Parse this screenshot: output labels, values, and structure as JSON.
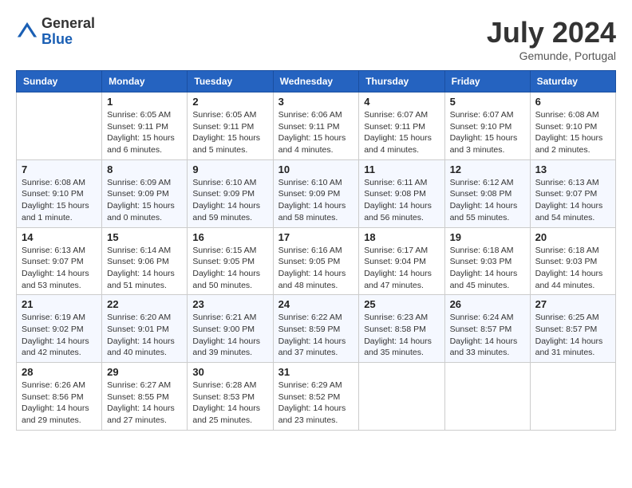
{
  "header": {
    "logo_general": "General",
    "logo_blue": "Blue",
    "month_title": "July 2024",
    "location": "Gemunde, Portugal"
  },
  "weekdays": [
    "Sunday",
    "Monday",
    "Tuesday",
    "Wednesday",
    "Thursday",
    "Friday",
    "Saturday"
  ],
  "weeks": [
    [
      {
        "day": "",
        "sunrise": "",
        "sunset": "",
        "daylight": ""
      },
      {
        "day": "1",
        "sunrise": "Sunrise: 6:05 AM",
        "sunset": "Sunset: 9:11 PM",
        "daylight": "Daylight: 15 hours and 6 minutes."
      },
      {
        "day": "2",
        "sunrise": "Sunrise: 6:05 AM",
        "sunset": "Sunset: 9:11 PM",
        "daylight": "Daylight: 15 hours and 5 minutes."
      },
      {
        "day": "3",
        "sunrise": "Sunrise: 6:06 AM",
        "sunset": "Sunset: 9:11 PM",
        "daylight": "Daylight: 15 hours and 4 minutes."
      },
      {
        "day": "4",
        "sunrise": "Sunrise: 6:07 AM",
        "sunset": "Sunset: 9:11 PM",
        "daylight": "Daylight: 15 hours and 4 minutes."
      },
      {
        "day": "5",
        "sunrise": "Sunrise: 6:07 AM",
        "sunset": "Sunset: 9:10 PM",
        "daylight": "Daylight: 15 hours and 3 minutes."
      },
      {
        "day": "6",
        "sunrise": "Sunrise: 6:08 AM",
        "sunset": "Sunset: 9:10 PM",
        "daylight": "Daylight: 15 hours and 2 minutes."
      }
    ],
    [
      {
        "day": "7",
        "sunrise": "Sunrise: 6:08 AM",
        "sunset": "Sunset: 9:10 PM",
        "daylight": "Daylight: 15 hours and 1 minute."
      },
      {
        "day": "8",
        "sunrise": "Sunrise: 6:09 AM",
        "sunset": "Sunset: 9:09 PM",
        "daylight": "Daylight: 15 hours and 0 minutes."
      },
      {
        "day": "9",
        "sunrise": "Sunrise: 6:10 AM",
        "sunset": "Sunset: 9:09 PM",
        "daylight": "Daylight: 14 hours and 59 minutes."
      },
      {
        "day": "10",
        "sunrise": "Sunrise: 6:10 AM",
        "sunset": "Sunset: 9:09 PM",
        "daylight": "Daylight: 14 hours and 58 minutes."
      },
      {
        "day": "11",
        "sunrise": "Sunrise: 6:11 AM",
        "sunset": "Sunset: 9:08 PM",
        "daylight": "Daylight: 14 hours and 56 minutes."
      },
      {
        "day": "12",
        "sunrise": "Sunrise: 6:12 AM",
        "sunset": "Sunset: 9:08 PM",
        "daylight": "Daylight: 14 hours and 55 minutes."
      },
      {
        "day": "13",
        "sunrise": "Sunrise: 6:13 AM",
        "sunset": "Sunset: 9:07 PM",
        "daylight": "Daylight: 14 hours and 54 minutes."
      }
    ],
    [
      {
        "day": "14",
        "sunrise": "Sunrise: 6:13 AM",
        "sunset": "Sunset: 9:07 PM",
        "daylight": "Daylight: 14 hours and 53 minutes."
      },
      {
        "day": "15",
        "sunrise": "Sunrise: 6:14 AM",
        "sunset": "Sunset: 9:06 PM",
        "daylight": "Daylight: 14 hours and 51 minutes."
      },
      {
        "day": "16",
        "sunrise": "Sunrise: 6:15 AM",
        "sunset": "Sunset: 9:05 PM",
        "daylight": "Daylight: 14 hours and 50 minutes."
      },
      {
        "day": "17",
        "sunrise": "Sunrise: 6:16 AM",
        "sunset": "Sunset: 9:05 PM",
        "daylight": "Daylight: 14 hours and 48 minutes."
      },
      {
        "day": "18",
        "sunrise": "Sunrise: 6:17 AM",
        "sunset": "Sunset: 9:04 PM",
        "daylight": "Daylight: 14 hours and 47 minutes."
      },
      {
        "day": "19",
        "sunrise": "Sunrise: 6:18 AM",
        "sunset": "Sunset: 9:03 PM",
        "daylight": "Daylight: 14 hours and 45 minutes."
      },
      {
        "day": "20",
        "sunrise": "Sunrise: 6:18 AM",
        "sunset": "Sunset: 9:03 PM",
        "daylight": "Daylight: 14 hours and 44 minutes."
      }
    ],
    [
      {
        "day": "21",
        "sunrise": "Sunrise: 6:19 AM",
        "sunset": "Sunset: 9:02 PM",
        "daylight": "Daylight: 14 hours and 42 minutes."
      },
      {
        "day": "22",
        "sunrise": "Sunrise: 6:20 AM",
        "sunset": "Sunset: 9:01 PM",
        "daylight": "Daylight: 14 hours and 40 minutes."
      },
      {
        "day": "23",
        "sunrise": "Sunrise: 6:21 AM",
        "sunset": "Sunset: 9:00 PM",
        "daylight": "Daylight: 14 hours and 39 minutes."
      },
      {
        "day": "24",
        "sunrise": "Sunrise: 6:22 AM",
        "sunset": "Sunset: 8:59 PM",
        "daylight": "Daylight: 14 hours and 37 minutes."
      },
      {
        "day": "25",
        "sunrise": "Sunrise: 6:23 AM",
        "sunset": "Sunset: 8:58 PM",
        "daylight": "Daylight: 14 hours and 35 minutes."
      },
      {
        "day": "26",
        "sunrise": "Sunrise: 6:24 AM",
        "sunset": "Sunset: 8:57 PM",
        "daylight": "Daylight: 14 hours and 33 minutes."
      },
      {
        "day": "27",
        "sunrise": "Sunrise: 6:25 AM",
        "sunset": "Sunset: 8:57 PM",
        "daylight": "Daylight: 14 hours and 31 minutes."
      }
    ],
    [
      {
        "day": "28",
        "sunrise": "Sunrise: 6:26 AM",
        "sunset": "Sunset: 8:56 PM",
        "daylight": "Daylight: 14 hours and 29 minutes."
      },
      {
        "day": "29",
        "sunrise": "Sunrise: 6:27 AM",
        "sunset": "Sunset: 8:55 PM",
        "daylight": "Daylight: 14 hours and 27 minutes."
      },
      {
        "day": "30",
        "sunrise": "Sunrise: 6:28 AM",
        "sunset": "Sunset: 8:53 PM",
        "daylight": "Daylight: 14 hours and 25 minutes."
      },
      {
        "day": "31",
        "sunrise": "Sunrise: 6:29 AM",
        "sunset": "Sunset: 8:52 PM",
        "daylight": "Daylight: 14 hours and 23 minutes."
      },
      {
        "day": "",
        "sunrise": "",
        "sunset": "",
        "daylight": ""
      },
      {
        "day": "",
        "sunrise": "",
        "sunset": "",
        "daylight": ""
      },
      {
        "day": "",
        "sunrise": "",
        "sunset": "",
        "daylight": ""
      }
    ]
  ]
}
